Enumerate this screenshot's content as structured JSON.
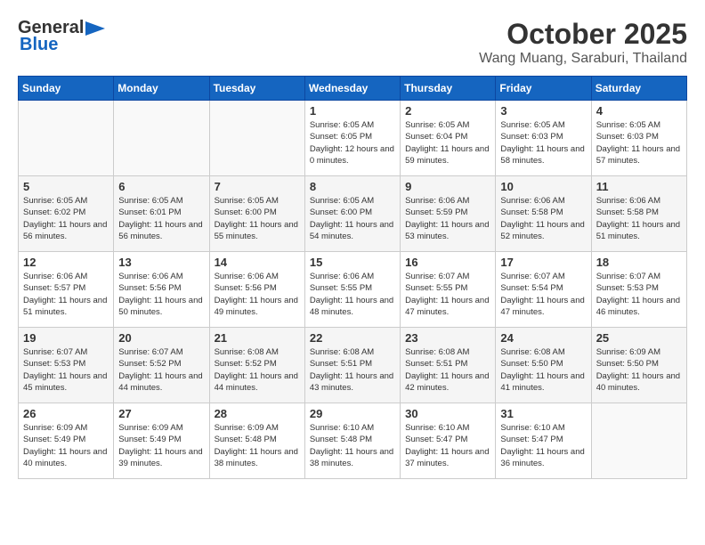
{
  "header": {
    "logo_general": "General",
    "logo_blue": "Blue",
    "month": "October 2025",
    "location": "Wang Muang, Saraburi, Thailand"
  },
  "weekdays": [
    "Sunday",
    "Monday",
    "Tuesday",
    "Wednesday",
    "Thursday",
    "Friday",
    "Saturday"
  ],
  "weeks": [
    [
      {
        "day": "",
        "sunrise": "",
        "sunset": "",
        "daylight": ""
      },
      {
        "day": "",
        "sunrise": "",
        "sunset": "",
        "daylight": ""
      },
      {
        "day": "",
        "sunrise": "",
        "sunset": "",
        "daylight": ""
      },
      {
        "day": "1",
        "sunrise": "Sunrise: 6:05 AM",
        "sunset": "Sunset: 6:05 PM",
        "daylight": "Daylight: 12 hours and 0 minutes."
      },
      {
        "day": "2",
        "sunrise": "Sunrise: 6:05 AM",
        "sunset": "Sunset: 6:04 PM",
        "daylight": "Daylight: 11 hours and 59 minutes."
      },
      {
        "day": "3",
        "sunrise": "Sunrise: 6:05 AM",
        "sunset": "Sunset: 6:03 PM",
        "daylight": "Daylight: 11 hours and 58 minutes."
      },
      {
        "day": "4",
        "sunrise": "Sunrise: 6:05 AM",
        "sunset": "Sunset: 6:03 PM",
        "daylight": "Daylight: 11 hours and 57 minutes."
      }
    ],
    [
      {
        "day": "5",
        "sunrise": "Sunrise: 6:05 AM",
        "sunset": "Sunset: 6:02 PM",
        "daylight": "Daylight: 11 hours and 56 minutes."
      },
      {
        "day": "6",
        "sunrise": "Sunrise: 6:05 AM",
        "sunset": "Sunset: 6:01 PM",
        "daylight": "Daylight: 11 hours and 56 minutes."
      },
      {
        "day": "7",
        "sunrise": "Sunrise: 6:05 AM",
        "sunset": "Sunset: 6:00 PM",
        "daylight": "Daylight: 11 hours and 55 minutes."
      },
      {
        "day": "8",
        "sunrise": "Sunrise: 6:05 AM",
        "sunset": "Sunset: 6:00 PM",
        "daylight": "Daylight: 11 hours and 54 minutes."
      },
      {
        "day": "9",
        "sunrise": "Sunrise: 6:06 AM",
        "sunset": "Sunset: 5:59 PM",
        "daylight": "Daylight: 11 hours and 53 minutes."
      },
      {
        "day": "10",
        "sunrise": "Sunrise: 6:06 AM",
        "sunset": "Sunset: 5:58 PM",
        "daylight": "Daylight: 11 hours and 52 minutes."
      },
      {
        "day": "11",
        "sunrise": "Sunrise: 6:06 AM",
        "sunset": "Sunset: 5:58 PM",
        "daylight": "Daylight: 11 hours and 51 minutes."
      }
    ],
    [
      {
        "day": "12",
        "sunrise": "Sunrise: 6:06 AM",
        "sunset": "Sunset: 5:57 PM",
        "daylight": "Daylight: 11 hours and 51 minutes."
      },
      {
        "day": "13",
        "sunrise": "Sunrise: 6:06 AM",
        "sunset": "Sunset: 5:56 PM",
        "daylight": "Daylight: 11 hours and 50 minutes."
      },
      {
        "day": "14",
        "sunrise": "Sunrise: 6:06 AM",
        "sunset": "Sunset: 5:56 PM",
        "daylight": "Daylight: 11 hours and 49 minutes."
      },
      {
        "day": "15",
        "sunrise": "Sunrise: 6:06 AM",
        "sunset": "Sunset: 5:55 PM",
        "daylight": "Daylight: 11 hours and 48 minutes."
      },
      {
        "day": "16",
        "sunrise": "Sunrise: 6:07 AM",
        "sunset": "Sunset: 5:55 PM",
        "daylight": "Daylight: 11 hours and 47 minutes."
      },
      {
        "day": "17",
        "sunrise": "Sunrise: 6:07 AM",
        "sunset": "Sunset: 5:54 PM",
        "daylight": "Daylight: 11 hours and 47 minutes."
      },
      {
        "day": "18",
        "sunrise": "Sunrise: 6:07 AM",
        "sunset": "Sunset: 5:53 PM",
        "daylight": "Daylight: 11 hours and 46 minutes."
      }
    ],
    [
      {
        "day": "19",
        "sunrise": "Sunrise: 6:07 AM",
        "sunset": "Sunset: 5:53 PM",
        "daylight": "Daylight: 11 hours and 45 minutes."
      },
      {
        "day": "20",
        "sunrise": "Sunrise: 6:07 AM",
        "sunset": "Sunset: 5:52 PM",
        "daylight": "Daylight: 11 hours and 44 minutes."
      },
      {
        "day": "21",
        "sunrise": "Sunrise: 6:08 AM",
        "sunset": "Sunset: 5:52 PM",
        "daylight": "Daylight: 11 hours and 44 minutes."
      },
      {
        "day": "22",
        "sunrise": "Sunrise: 6:08 AM",
        "sunset": "Sunset: 5:51 PM",
        "daylight": "Daylight: 11 hours and 43 minutes."
      },
      {
        "day": "23",
        "sunrise": "Sunrise: 6:08 AM",
        "sunset": "Sunset: 5:51 PM",
        "daylight": "Daylight: 11 hours and 42 minutes."
      },
      {
        "day": "24",
        "sunrise": "Sunrise: 6:08 AM",
        "sunset": "Sunset: 5:50 PM",
        "daylight": "Daylight: 11 hours and 41 minutes."
      },
      {
        "day": "25",
        "sunrise": "Sunrise: 6:09 AM",
        "sunset": "Sunset: 5:50 PM",
        "daylight": "Daylight: 11 hours and 40 minutes."
      }
    ],
    [
      {
        "day": "26",
        "sunrise": "Sunrise: 6:09 AM",
        "sunset": "Sunset: 5:49 PM",
        "daylight": "Daylight: 11 hours and 40 minutes."
      },
      {
        "day": "27",
        "sunrise": "Sunrise: 6:09 AM",
        "sunset": "Sunset: 5:49 PM",
        "daylight": "Daylight: 11 hours and 39 minutes."
      },
      {
        "day": "28",
        "sunrise": "Sunrise: 6:09 AM",
        "sunset": "Sunset: 5:48 PM",
        "daylight": "Daylight: 11 hours and 38 minutes."
      },
      {
        "day": "29",
        "sunrise": "Sunrise: 6:10 AM",
        "sunset": "Sunset: 5:48 PM",
        "daylight": "Daylight: 11 hours and 38 minutes."
      },
      {
        "day": "30",
        "sunrise": "Sunrise: 6:10 AM",
        "sunset": "Sunset: 5:47 PM",
        "daylight": "Daylight: 11 hours and 37 minutes."
      },
      {
        "day": "31",
        "sunrise": "Sunrise: 6:10 AM",
        "sunset": "Sunset: 5:47 PM",
        "daylight": "Daylight: 11 hours and 36 minutes."
      },
      {
        "day": "",
        "sunrise": "",
        "sunset": "",
        "daylight": ""
      }
    ]
  ]
}
